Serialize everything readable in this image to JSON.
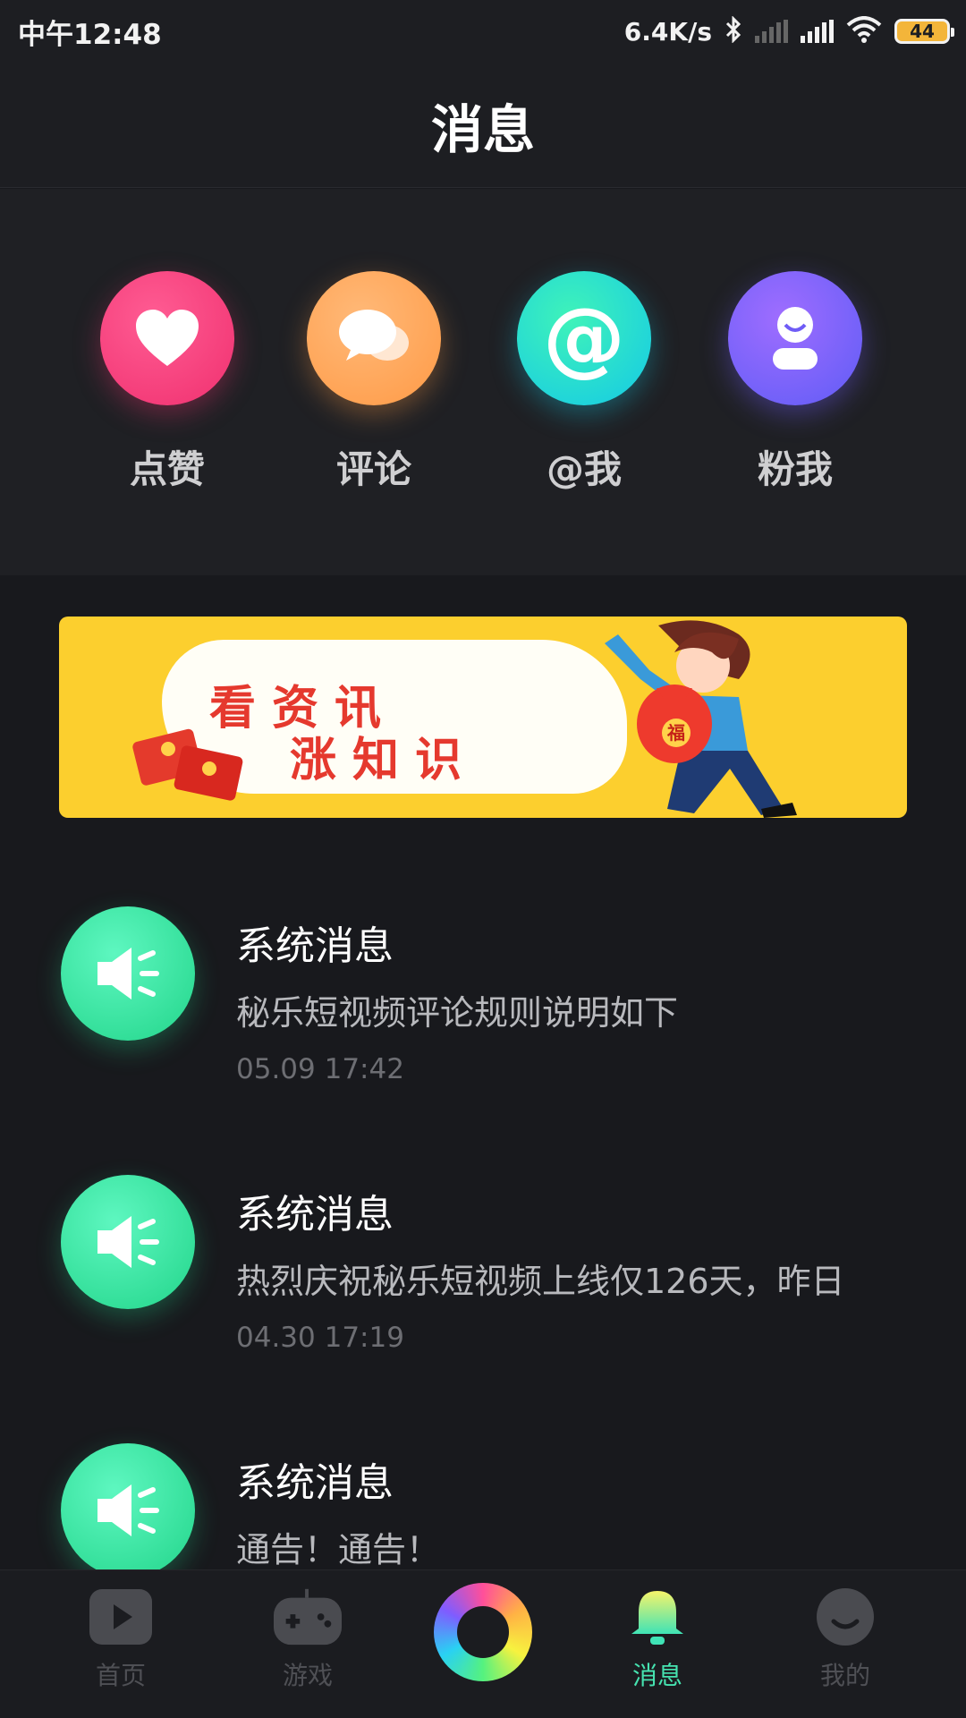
{
  "status_bar": {
    "time": "中午12:48",
    "net_speed": "6.4K/s",
    "battery": "44"
  },
  "header": {
    "title": "消息"
  },
  "categories": [
    {
      "label": "点赞",
      "icon": "heart-icon"
    },
    {
      "label": "评论",
      "icon": "comment-icon"
    },
    {
      "label": "@我",
      "icon": "at-icon",
      "glyph": "@"
    },
    {
      "label": "粉我",
      "icon": "follower-icon"
    }
  ],
  "banner": {
    "line1": "看资讯",
    "line2": "涨知识",
    "bag_text": "福"
  },
  "messages": [
    {
      "title": "系统消息",
      "preview": "秘乐短视频评论规则说明如下",
      "time": "05.09 17:42",
      "icon": "speaker-icon"
    },
    {
      "title": "系统消息",
      "preview": "热烈庆祝秘乐短视频上线仅126天，昨日",
      "time": "04.30 17:19",
      "icon": "speaker-icon"
    },
    {
      "title": "系统消息",
      "preview": "通告！通告！",
      "time": "",
      "icon": "speaker-icon"
    }
  ],
  "tab_bar": {
    "tabs": [
      {
        "label": "首页",
        "icon": "play-icon",
        "active": false
      },
      {
        "label": "游戏",
        "icon": "gamepad-icon",
        "active": false
      },
      {
        "label": "消息",
        "icon": "bell-icon",
        "active": true
      },
      {
        "label": "我的",
        "icon": "smile-icon",
        "active": false
      }
    ],
    "center_icon": "create-ring-icon"
  },
  "colors": {
    "background": "#18191d",
    "accent": "#46e3b0",
    "like": "#f0306f",
    "comment": "#ff9a46",
    "at": "#14c9e6",
    "fans": "#6f5cf6",
    "banner": "#fccf2e"
  }
}
